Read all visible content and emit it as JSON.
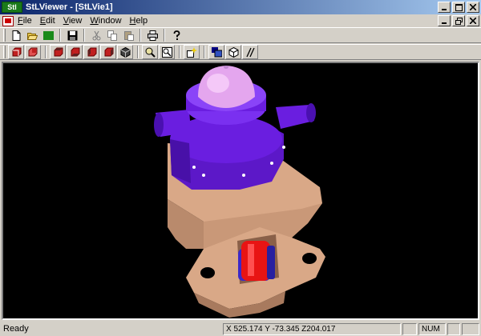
{
  "window": {
    "app_logo": "Stl",
    "title": "StLViewer - [StLVie1]"
  },
  "menu": [
    {
      "underline": "F",
      "rest": "ile"
    },
    {
      "underline": "E",
      "rest": "dit"
    },
    {
      "underline": "V",
      "rest": "iew"
    },
    {
      "underline": "W",
      "rest": "indow"
    },
    {
      "underline": "H",
      "rest": "elp"
    }
  ],
  "toolbar1": {
    "icons": [
      "new-file-icon",
      "open-folder-icon",
      "stl-icon",
      "save-icon",
      "cut-icon",
      "copy-icon",
      "paste-icon",
      "print-icon",
      "help-icon"
    ],
    "stl_label": "Stl"
  },
  "toolbar2": {
    "icons": [
      "view-front-icon",
      "view-back-icon",
      "view-top-icon",
      "view-bottom-icon",
      "view-left-icon",
      "view-right-icon",
      "view-iso-icon",
      "zoom-icon",
      "zoom-fit-icon",
      "light-icon",
      "multi-view-icon",
      "shaded-icon",
      "wireframe-icon"
    ]
  },
  "status": {
    "text": "Ready",
    "coords": "X 525.174  Y -73.345  Z204.017",
    "num": "NUM"
  },
  "colors": {
    "part_tan": "#d9a887",
    "part_purple": "#6a1ee0",
    "dome_lavender": "#e4a6ee",
    "roller_red": "#e81414",
    "roller_blue": "#3a28c8"
  }
}
